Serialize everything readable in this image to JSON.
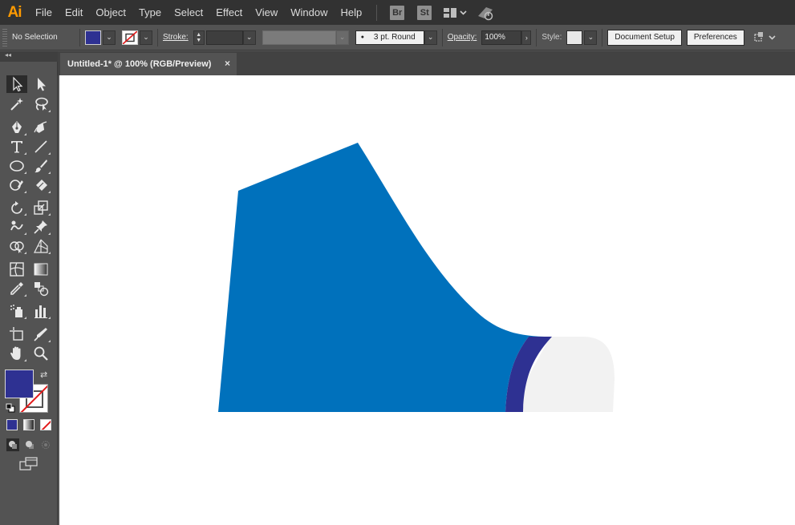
{
  "app": {
    "logo": "Ai"
  },
  "menu": {
    "items": [
      "File",
      "Edit",
      "Object",
      "Type",
      "Select",
      "Effect",
      "View",
      "Window",
      "Help"
    ],
    "bridge_label": "Br",
    "stock_label": "St"
  },
  "controlbar": {
    "selection_label": "No Selection",
    "fill_color": "#2e3192",
    "stroke_label": "Stroke:",
    "brush_label": "3 pt. Round",
    "opacity_label": "Opacity:",
    "opacity_value": "100%",
    "style_label": "Style:",
    "document_setup_label": "Document Setup",
    "preferences_label": "Preferences"
  },
  "document": {
    "tab_title": "Untitled-1* @ 100% (RGB/Preview)",
    "close_glyph": "×"
  },
  "tools": {
    "fill_color": "#2e3192",
    "stroke_color": "none"
  },
  "artwork": {
    "shoe_body_color": "#0071bc",
    "toe_band_color": "#2e3192",
    "toe_cap_color": "#f2f2f2"
  }
}
